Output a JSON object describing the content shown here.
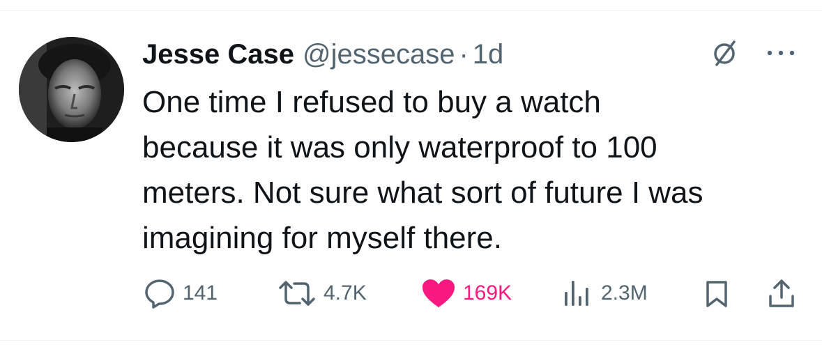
{
  "author": {
    "name": "Jesse Case",
    "handle": "@jessecase",
    "separator": "·",
    "time": "1d"
  },
  "tweet": {
    "lines": [
      "One time I refused to buy a watch",
      "because it was only waterproof to 100",
      "meters. Not sure what sort of future I was",
      "imagining for myself there."
    ]
  },
  "actions": {
    "replies": "141",
    "reposts": "4.7K",
    "likes": "169K",
    "views": "2.3M"
  },
  "icons": {
    "reply": "reply-icon",
    "repost": "repost-icon",
    "like": "heart-icon",
    "views": "views-icon",
    "bookmark": "bookmark-icon",
    "share": "share-icon",
    "grok": "grok-icon",
    "more": "more-icon"
  },
  "colors": {
    "text": "#0f1419",
    "secondary": "#536471",
    "like": "#f91880",
    "divider": "#eff3f4"
  }
}
